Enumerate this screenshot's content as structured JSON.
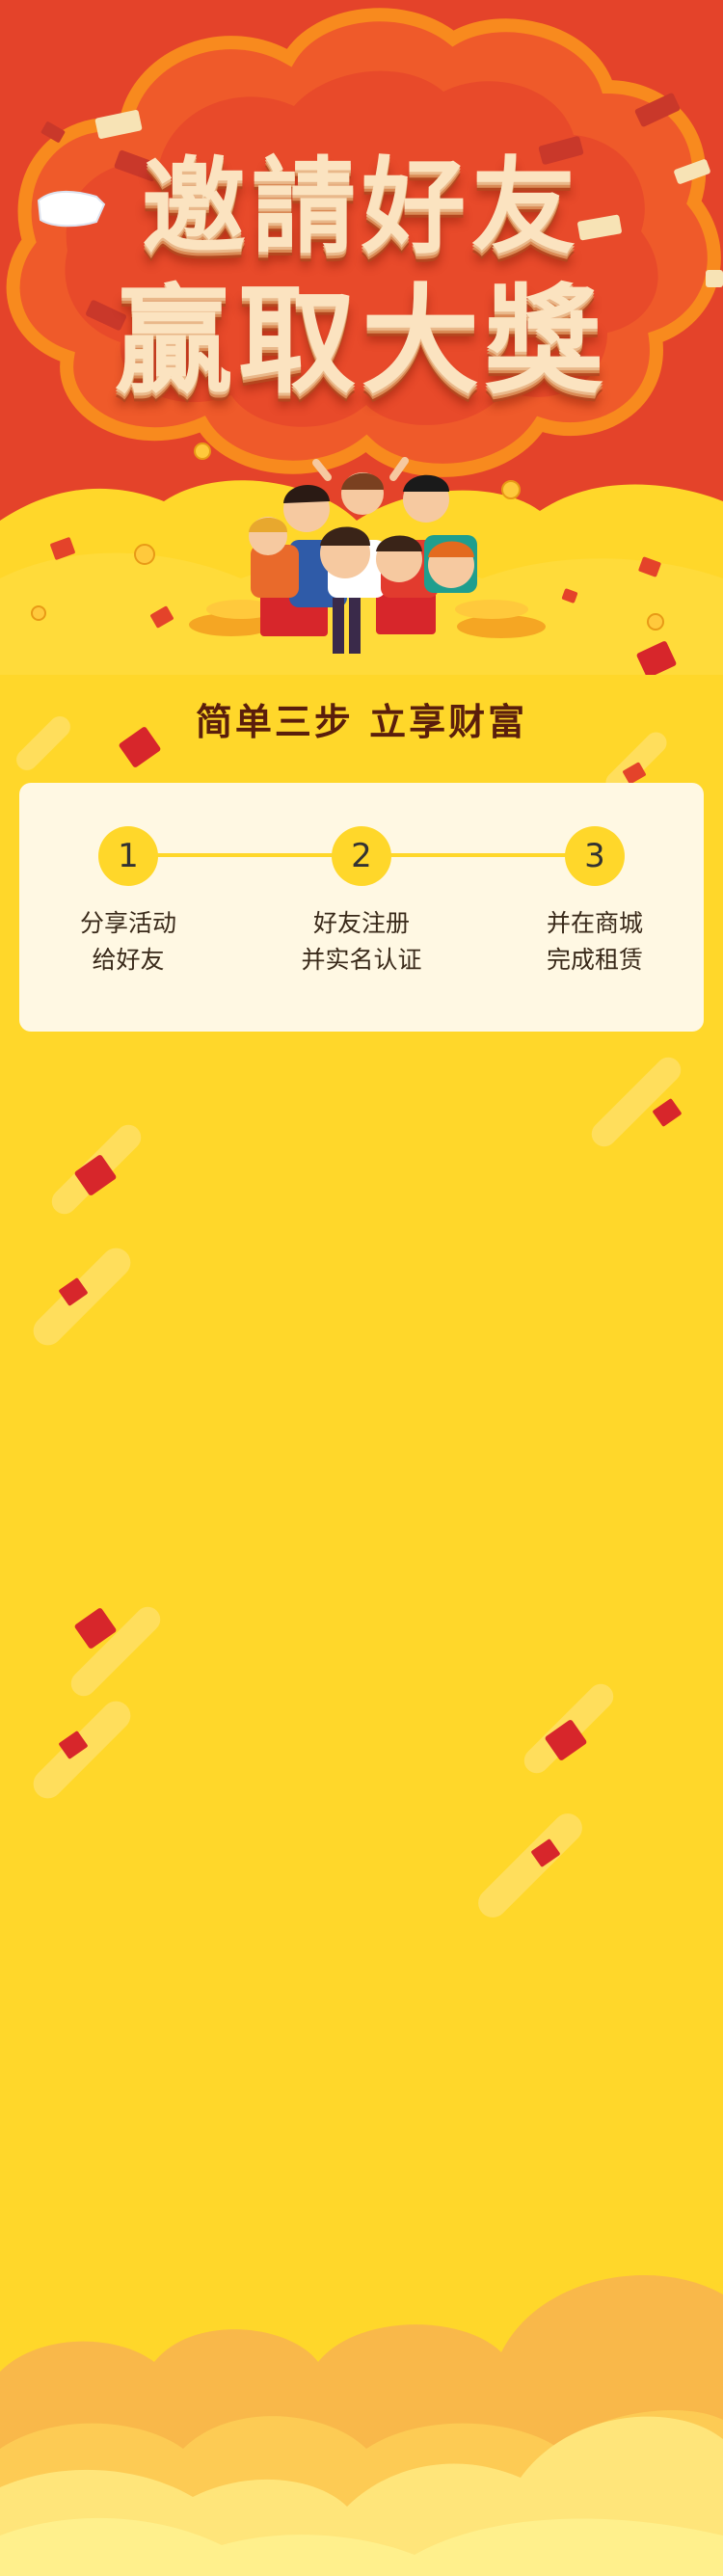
{
  "banner": {
    "title_line1": "邀請好友",
    "title_line2": "贏取大獎"
  },
  "steps_section": {
    "title": "简单三步  立享财富",
    "steps": [
      {
        "number": "1",
        "line1": "分享活动",
        "line2": "给好友"
      },
      {
        "number": "2",
        "line1": "好友注册",
        "line2": "并实名认证"
      },
      {
        "number": "3",
        "line1": "并在商城",
        "line2": "完成租赁"
      }
    ]
  },
  "colors": {
    "background": "#FFD72A",
    "banner_red": "#E4432A",
    "card": "#FFF8E3",
    "heading": "#5A1E0C"
  }
}
